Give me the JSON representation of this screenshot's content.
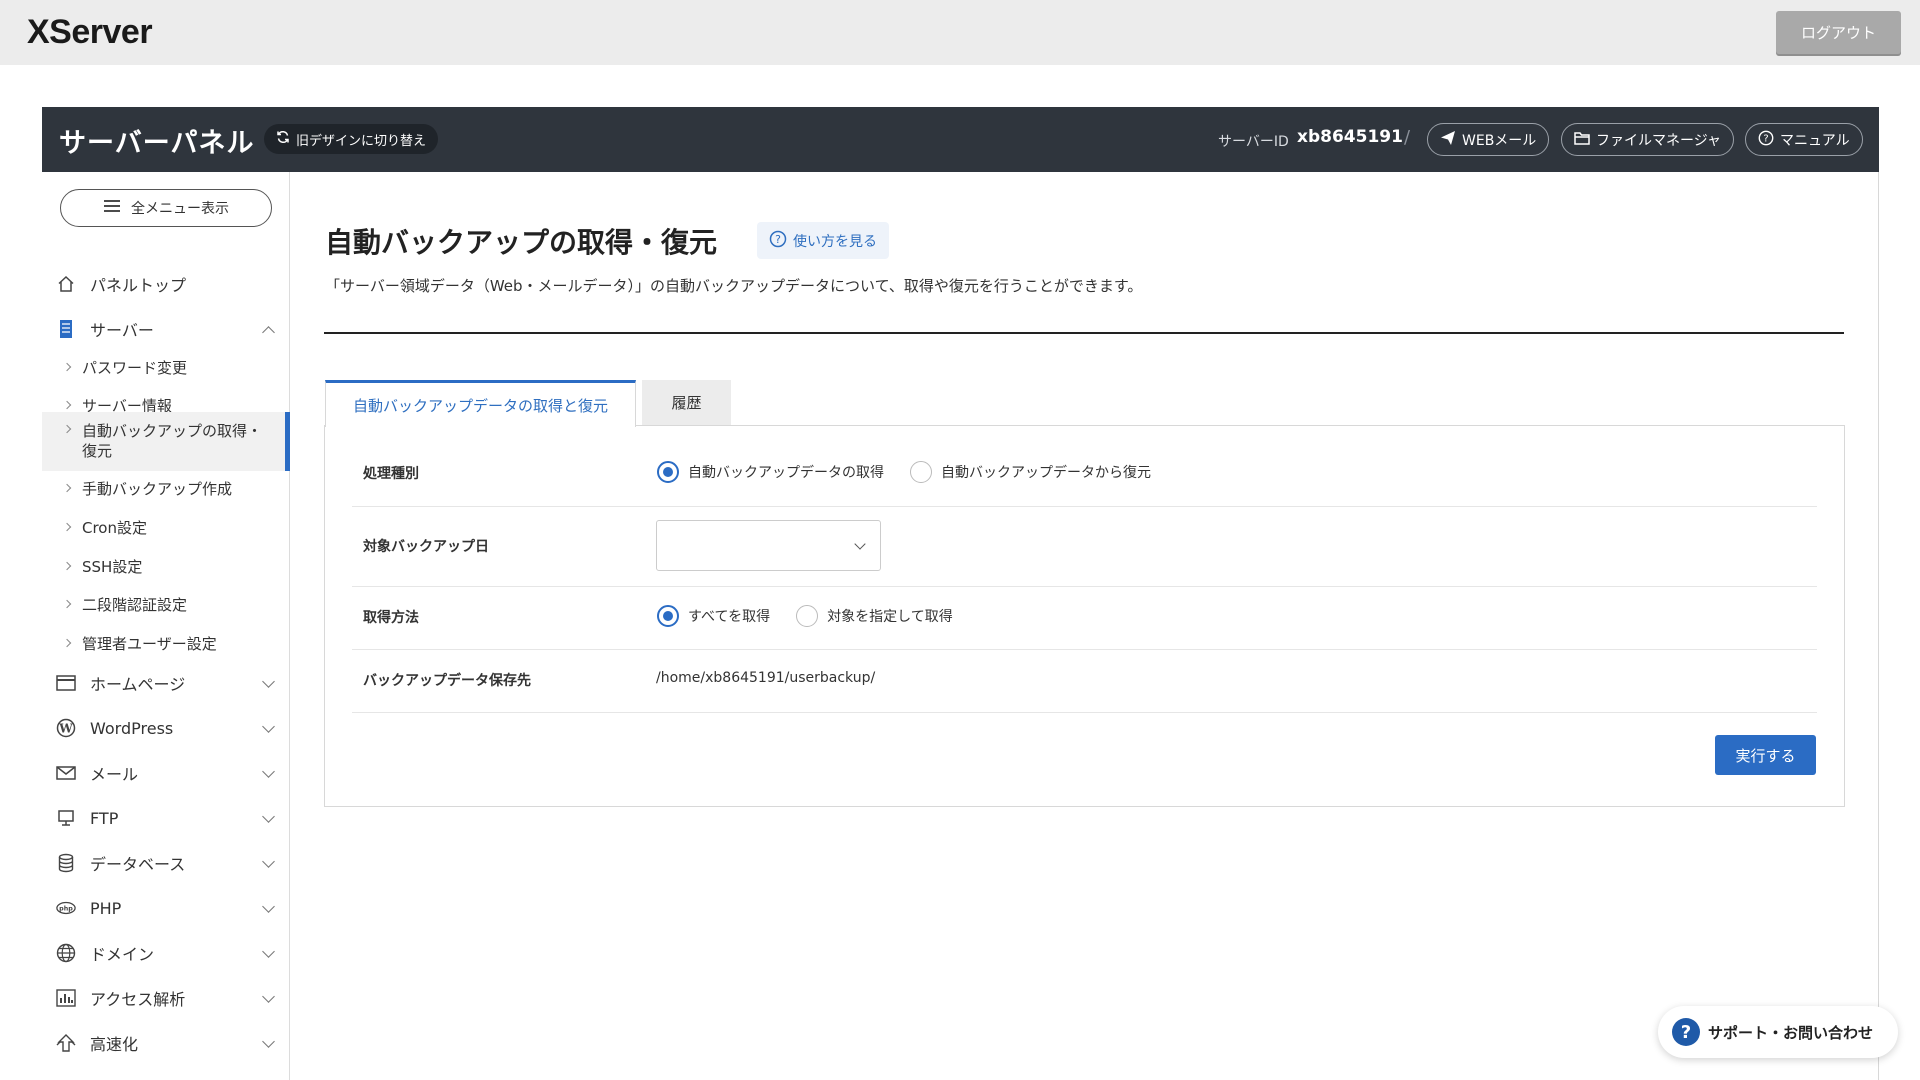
{
  "topbar": {
    "logo": "XServer",
    "logout_label": "ログアウト"
  },
  "header": {
    "title": "サーバーパネル",
    "old_design_label": "旧デザインに切り替え",
    "server_id_label": "サーバーID",
    "server_id": "xb8645191",
    "separator": "/",
    "webmail_label": "WEBメール",
    "file_manager_label": "ファイルマネージャ",
    "manual_label": "マニュアル"
  },
  "sidebar": {
    "menu_all_label": "全メニュー表示",
    "panel_top": "パネルトップ",
    "server": "サーバー",
    "server_sub": [
      "パスワード変更",
      "サーバー情報",
      "自動バックアップの取得・復元",
      "手動バックアップ作成",
      "Cron設定",
      "SSH設定",
      "二段階認証設定",
      "管理者ユーザー設定"
    ],
    "homepage": "ホームページ",
    "wordpress": "WordPress",
    "mail": "メール",
    "ftp": "FTP",
    "database": "データベース",
    "php": "PHP",
    "domain": "ドメイン",
    "access": "アクセス解析",
    "speed": "高速化"
  },
  "main": {
    "title": "自動バックアップの取得・復元",
    "howto_label": "使い方を見る",
    "description": "「サーバー領域データ（Web・メールデータ）」の自動バックアップデータについて、取得や復元を行うことができます。",
    "tabs": [
      "自動バックアップデータの取得と復元",
      "履歴"
    ],
    "form": {
      "process_label": "処理種別",
      "process_options": [
        "自動バックアップデータの取得",
        "自動バックアップデータから復元"
      ],
      "target_date_label": "対象バックアップ日",
      "target_date_value": "",
      "method_label": "取得方法",
      "method_options": [
        "すべてを取得",
        "対象を指定して取得"
      ],
      "save_path_label": "バックアップデータ保存先",
      "save_path_value": "/home/xb8645191/userbackup/"
    },
    "run_label": "実行する"
  },
  "support": {
    "label": "サポート・お問い合わせ"
  },
  "colors": {
    "accent": "#2b6cc4",
    "header_bg": "#2f353d",
    "topbar_bg": "#ececec"
  }
}
